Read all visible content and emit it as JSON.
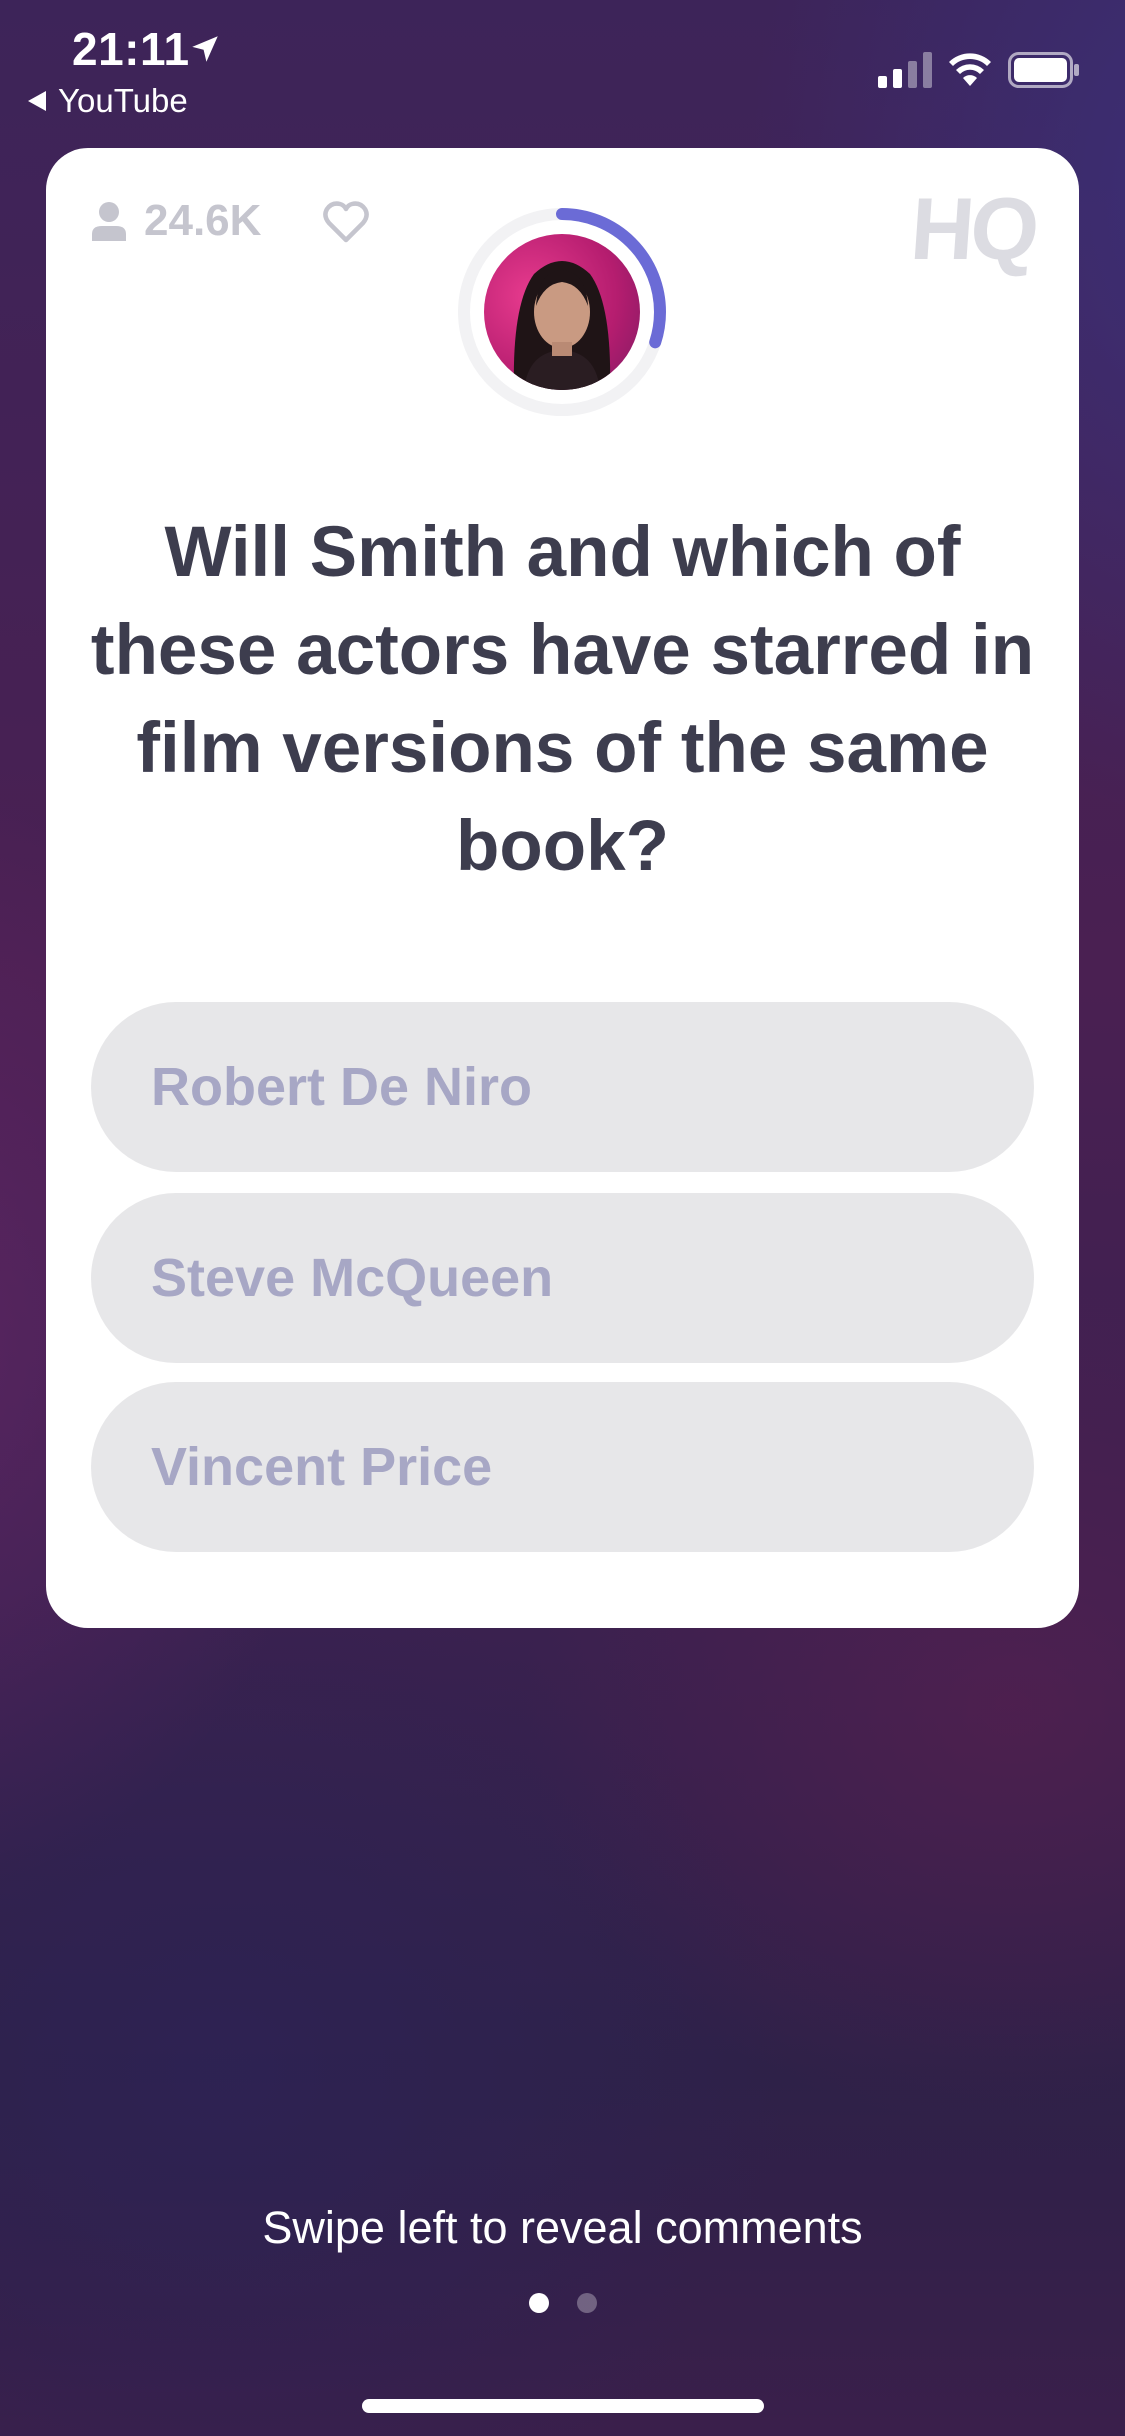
{
  "status_bar": {
    "time": "21:11",
    "back_app": "YouTube",
    "icons": [
      "location-arrow-icon",
      "cellular-signal-icon",
      "wifi-icon",
      "battery-icon"
    ]
  },
  "card": {
    "viewer_count": "24.6K",
    "logo": "HQ",
    "timer_progress": 0.3,
    "question": "Will Smith and which of these actors have starred in film versions of the same book?",
    "answers": [
      {
        "label": "Robert De Niro"
      },
      {
        "label": "Steve McQueen"
      },
      {
        "label": "Vincent Price"
      }
    ]
  },
  "footer": {
    "hint": "Swipe left to reveal comments",
    "pages": 2,
    "active_page": 1
  },
  "colors": {
    "accent": "#6b6bd6",
    "question_text": "#3d3d4e",
    "answer_text": "#a7a7c5",
    "answer_bg": "#e7e7e9"
  }
}
